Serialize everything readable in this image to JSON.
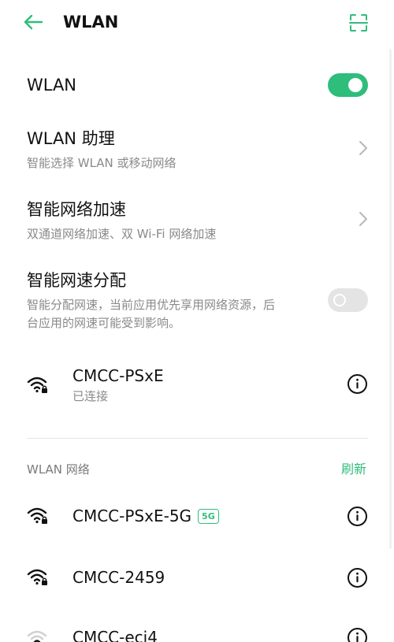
{
  "header": {
    "title": "WLAN",
    "back_icon": "back-arrow-icon",
    "scan_icon": "scan-icon"
  },
  "wlan_toggle": {
    "label": "WLAN",
    "state": "on"
  },
  "wlan_assistant": {
    "title": "WLAN 助理",
    "subtitle": "智能选择 WLAN 或移动网络"
  },
  "smart_acceleration": {
    "title": "智能网络加速",
    "subtitle": "双通道网络加速、双 Wi-Fi 网络加速"
  },
  "smart_speed_allocation": {
    "title": "智能网速分配",
    "subtitle_line1": "智能分配网速，当前应用优先享用网络资源，后",
    "subtitle_line2": "台应用的网速可能受到影响。",
    "state": "off"
  },
  "connected_network": {
    "name": "CMCC-PSxE",
    "status": "已连接"
  },
  "networks_section": {
    "label": "WLAN 网络",
    "refresh_label": "刷新"
  },
  "networks": [
    {
      "name": "CMCC-PSxE-5G",
      "badge": "5G"
    },
    {
      "name": "CMCC-2459",
      "badge": ""
    },
    {
      "name": "CMCC-eci4",
      "badge": ""
    }
  ],
  "colors": {
    "accent": "#2fbd7b",
    "toggle_off": "#e4e4e4",
    "secondary_text": "#8a8a8a"
  }
}
